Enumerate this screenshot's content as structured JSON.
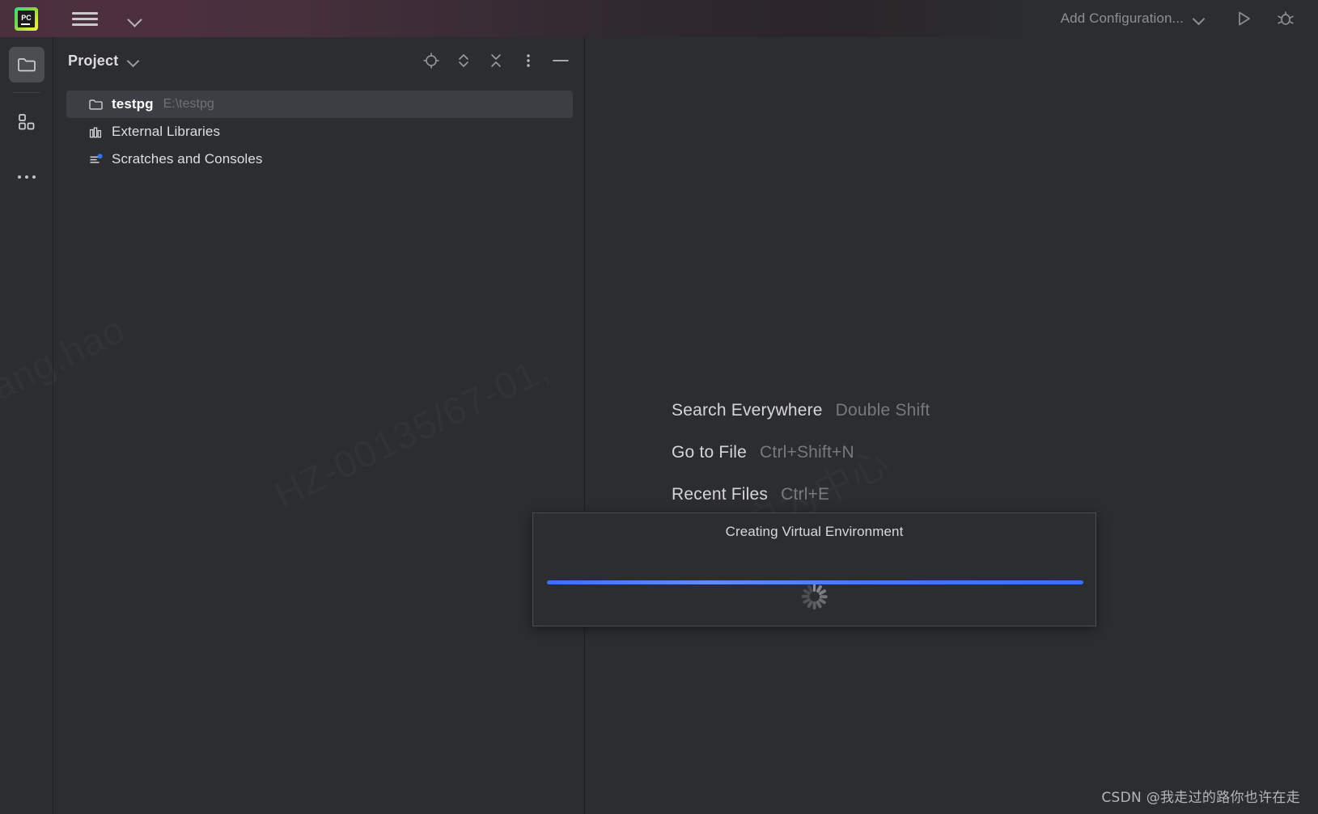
{
  "titlebar": {
    "app_logo_text": "PC",
    "menu_icon": "hamburger-menu-icon",
    "chevron_icon": "chevron-down-icon",
    "add_configuration_label": "Add Configuration...",
    "run_icon": "run-play-icon",
    "debug_icon": "debug-bug-icon"
  },
  "rail": {
    "items": [
      {
        "name": "project-tool-window",
        "icon": "folder-icon",
        "active": true
      },
      {
        "name": "structure-tool-window",
        "icon": "structure-blocks-icon",
        "active": false
      },
      {
        "name": "more-tool-windows",
        "icon": "more-ellipsis-icon",
        "active": false
      }
    ]
  },
  "project_panel": {
    "title": "Project",
    "tools": [
      {
        "name": "select-opened-file",
        "icon": "locate-target-icon"
      },
      {
        "name": "expand-collapse",
        "icon": "up-down-chevrons-icon"
      },
      {
        "name": "collapse-all",
        "icon": "collapse-all-icon"
      },
      {
        "name": "options-menu",
        "icon": "vertical-dots-icon"
      },
      {
        "name": "hide-panel",
        "icon": "minimize-dash-icon"
      }
    ],
    "tree": [
      {
        "label": "testpg",
        "sub": "E:\\testpg",
        "icon": "folder-icon",
        "selected": true
      },
      {
        "label": "External Libraries",
        "sub": "",
        "icon": "library-icon",
        "selected": false
      },
      {
        "label": "Scratches and Consoles",
        "sub": "",
        "icon": "scratches-icon",
        "selected": false
      }
    ]
  },
  "editor": {
    "hints": [
      {
        "name": "Search Everywhere",
        "key": "Double Shift"
      },
      {
        "name": "Go to File",
        "key": "Ctrl+Shift+N"
      },
      {
        "name": "Recent Files",
        "key": "Ctrl+E"
      }
    ],
    "watermarks": [
      "xianggang.hao",
      "HZ-00135/67-01,",
      "以用户为中心"
    ]
  },
  "dialog": {
    "title": "Creating Virtual Environment",
    "spinner_icon": "loading-spinner-icon",
    "progress_percent": 100,
    "progress_color": "#3574f0"
  },
  "footer": {
    "watermark": "CSDN @我走过的路你也许在走"
  },
  "colors": {
    "background": "#2b2d30",
    "panel_border": "#1e1f22",
    "titlebar_accent": "#4a2f3d",
    "selection": "#3b3e42",
    "accent_blue": "#3574f0",
    "text_primary": "#dfdfe0",
    "text_muted": "#76797d"
  }
}
